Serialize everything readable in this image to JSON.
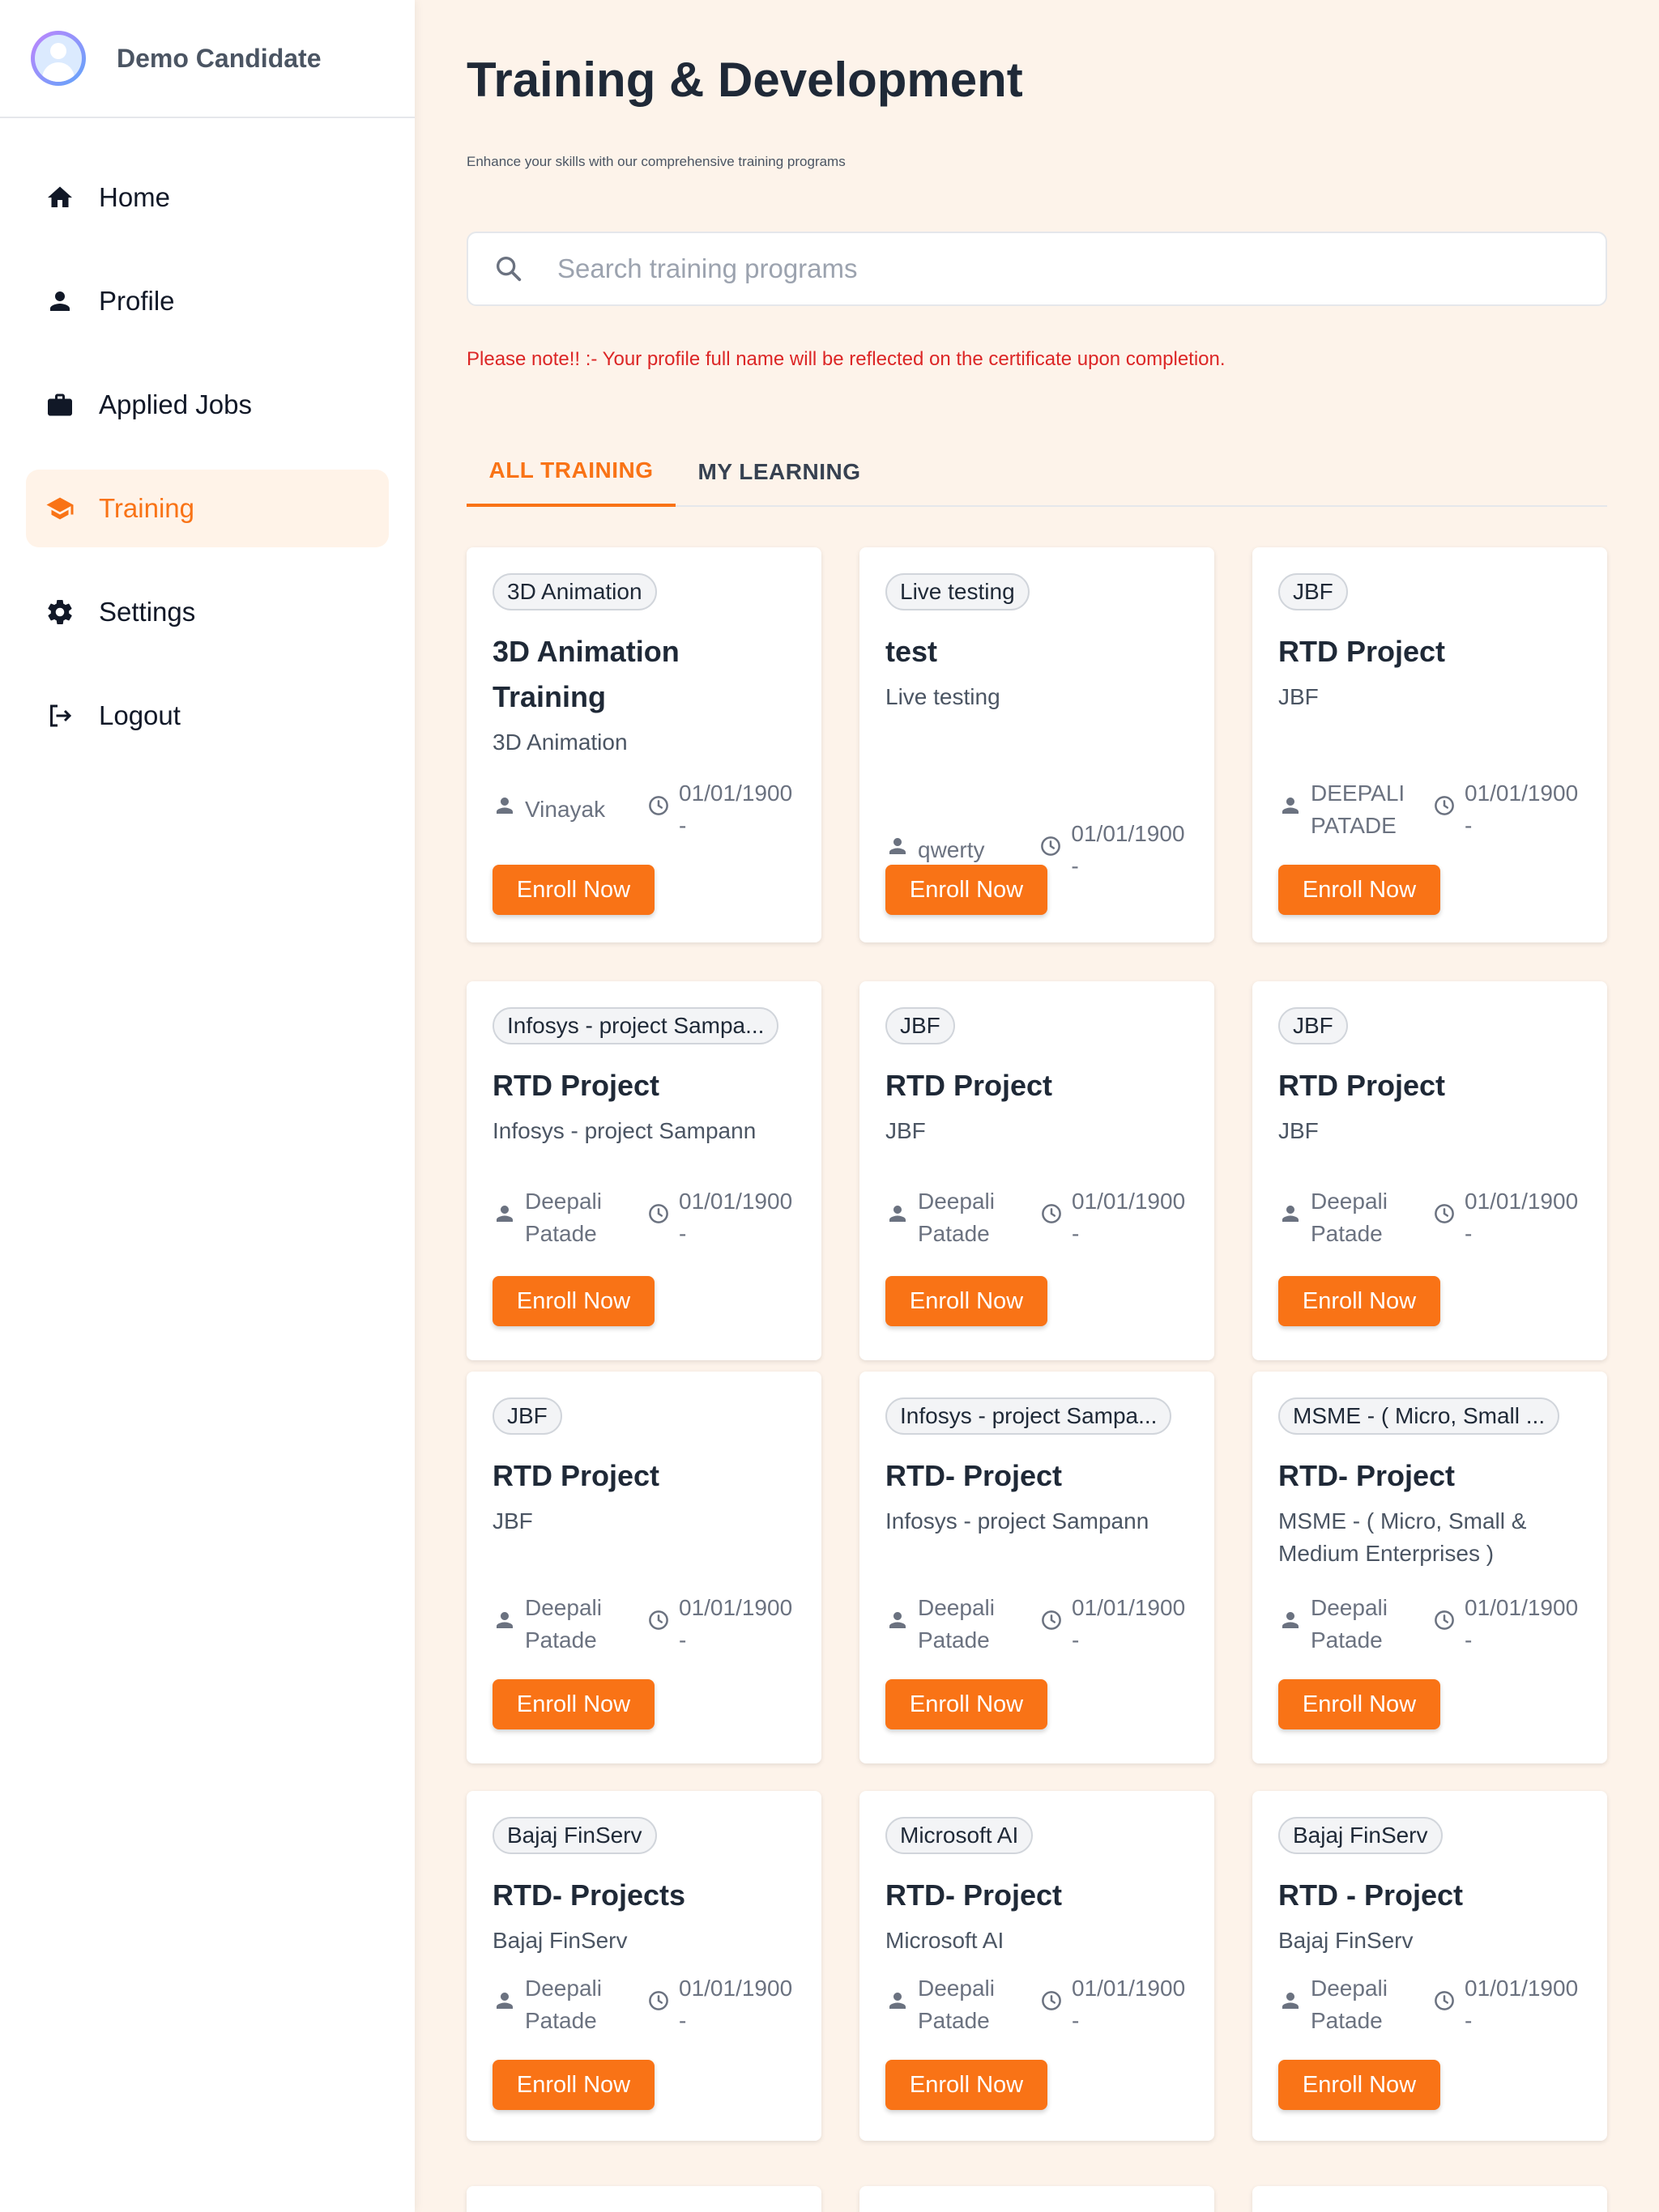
{
  "user": {
    "name": "Demo Candidate"
  },
  "nav": [
    {
      "label": "Home",
      "icon": "home-icon"
    },
    {
      "label": "Profile",
      "icon": "person-icon"
    },
    {
      "label": "Applied Jobs",
      "icon": "briefcase-icon"
    },
    {
      "label": "Training",
      "icon": "graduation-cap-icon",
      "active": true
    },
    {
      "label": "Settings",
      "icon": "gear-icon"
    },
    {
      "label": "Logout",
      "icon": "logout-icon"
    }
  ],
  "page": {
    "title": "Training & Development",
    "subtitle": "Enhance your skills with our comprehensive training programs",
    "note": "Please note!! :- Your profile full name will be reflected on the certificate upon completion."
  },
  "search": {
    "placeholder": "Search training programs",
    "value": ""
  },
  "tabs": [
    {
      "label": "ALL TRAINING",
      "active": true
    },
    {
      "label": "MY LEARNING",
      "active": false
    }
  ],
  "enroll_label": "Enroll Now",
  "cards": [
    {
      "chip": "3D Animation",
      "title": "3D Animation Training",
      "desc": "3D Animation",
      "author": "Vinayak",
      "date": "01/01/1900 -"
    },
    {
      "chip": "Live testing",
      "title": "test",
      "desc": "Live testing",
      "author": "qwerty",
      "date": "01/01/1900 -"
    },
    {
      "chip": "JBF",
      "title": "RTD Project",
      "desc": "JBF",
      "author": "DEEPALI PATADE",
      "date": "01/01/1900 -"
    },
    {
      "chip": "Infosys - project Sampa...",
      "title": "RTD Project",
      "desc": "Infosys - project Sampann",
      "author": "Deepali Patade",
      "date": "01/01/1900 -"
    },
    {
      "chip": "JBF",
      "title": "RTD Project",
      "desc": "JBF",
      "author": "Deepali Patade",
      "date": "01/01/1900 -"
    },
    {
      "chip": "JBF",
      "title": "RTD Project",
      "desc": "JBF",
      "author": "Deepali Patade",
      "date": "01/01/1900 -"
    },
    {
      "chip": "JBF",
      "title": "RTD Project",
      "desc": "JBF",
      "author": "Deepali Patade",
      "date": "01/01/1900 -"
    },
    {
      "chip": "Infosys - project Sampa...",
      "title": "RTD- Project",
      "desc": "Infosys - project Sampann",
      "author": "Deepali Patade",
      "date": "01/01/1900 -"
    },
    {
      "chip": "MSME - ( Micro, Small ...",
      "title": "RTD- Project",
      "desc": "MSME - ( Micro, Small & Medium Enterprises )",
      "author": "Deepali Patade",
      "date": "01/01/1900 -"
    },
    {
      "chip": "Bajaj FinServ",
      "title": "RTD- Projects",
      "desc": "Bajaj FinServ",
      "author": "Deepali Patade",
      "date": "01/01/1900 -"
    },
    {
      "chip": "Microsoft AI",
      "title": "RTD- Project",
      "desc": "Microsoft AI",
      "author": "Deepali Patade",
      "date": "01/01/1900 -"
    },
    {
      "chip": "Bajaj FinServ",
      "title": "RTD - Project",
      "desc": "Bajaj FinServ",
      "author": "Deepali Patade",
      "date": "01/01/1900 -"
    }
  ],
  "colors": {
    "accent": "#f97316",
    "note": "#dc2626",
    "background": "#fdf3ea"
  }
}
